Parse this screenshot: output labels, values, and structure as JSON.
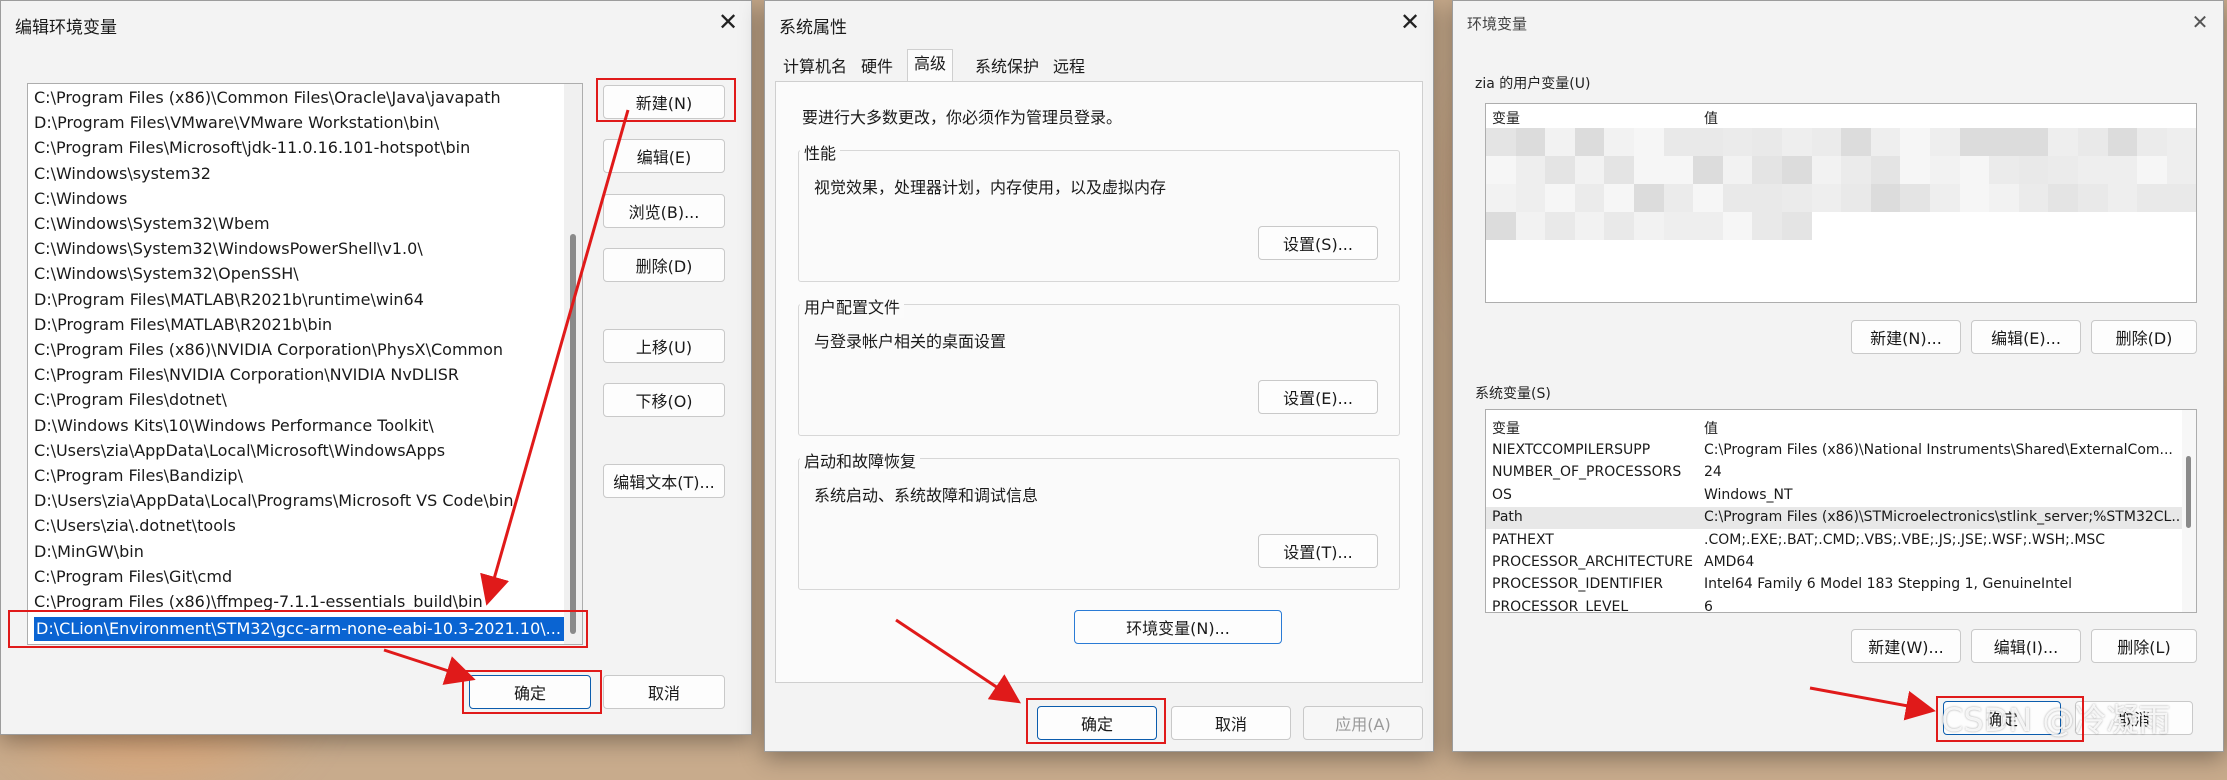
{
  "colors": {
    "highlight": "#e01a1a",
    "selection": "#0a64d2",
    "primary_border": "#0b5cad"
  },
  "edit_env_dialog": {
    "title": "编辑环境变量",
    "paths": [
      "C:\\Program Files (x86)\\Common Files\\Oracle\\Java\\javapath",
      "D:\\Program Files\\VMware\\VMware Workstation\\bin\\",
      "C:\\Program Files\\Microsoft\\jdk-11.0.16.101-hotspot\\bin",
      "C:\\Windows\\system32",
      "C:\\Windows",
      "C:\\Windows\\System32\\Wbem",
      "C:\\Windows\\System32\\WindowsPowerShell\\v1.0\\",
      "C:\\Windows\\System32\\OpenSSH\\",
      "D:\\Program Files\\MATLAB\\R2021b\\runtime\\win64",
      "D:\\Program Files\\MATLAB\\R2021b\\bin",
      "C:\\Program Files (x86)\\NVIDIA Corporation\\PhysX\\Common",
      "C:\\Program Files\\NVIDIA Corporation\\NVIDIA NvDLISR",
      "C:\\Program Files\\dotnet\\",
      "D:\\Windows Kits\\10\\Windows Performance Toolkit\\",
      "C:\\Users\\zia\\AppData\\Local\\Microsoft\\WindowsApps",
      "C:\\Program Files\\Bandizip\\",
      "D:\\Users\\zia\\AppData\\Local\\Programs\\Microsoft VS Code\\bin",
      "C:\\Users\\zia\\.dotnet\\tools",
      "D:\\MinGW\\bin",
      "C:\\Program Files\\Git\\cmd",
      "C:\\Program Files (x86)\\ffmpeg-7.1.1-essentials_build\\bin"
    ],
    "selected_path": "D:\\CLion\\Environment\\STM32\\gcc-arm-none-eabi-10.3-2021.10\\...",
    "buttons": {
      "new": "新建(N)",
      "edit": "编辑(E)",
      "browse": "浏览(B)...",
      "delete": "删除(D)",
      "move_up": "上移(U)",
      "move_down": "下移(O)",
      "edit_text": "编辑文本(T)...",
      "ok": "确定",
      "cancel": "取消"
    }
  },
  "system_properties": {
    "title": "系统属性",
    "tabs": [
      "计算机名",
      "硬件",
      "高级",
      "系统保护",
      "远程"
    ],
    "active_tab": "高级",
    "admin_hint": "要进行大多数更改，你必须作为管理员登录。",
    "performance": {
      "label": "性能",
      "desc": "视觉效果，处理器计划，内存使用，以及虚拟内存",
      "button": "设置(S)..."
    },
    "user_profile": {
      "label": "用户配置文件",
      "desc": "与登录帐户相关的桌面设置",
      "button": "设置(E)..."
    },
    "startup": {
      "label": "启动和故障恢复",
      "desc": "系统启动、系统故障和调试信息",
      "button": "设置(T)..."
    },
    "env_button": "环境变量(N)...",
    "ok": "确定",
    "cancel": "取消",
    "apply": "应用(A)"
  },
  "env_vars_window": {
    "title": "环境变量",
    "user_section_label": "zia 的用户变量(U)",
    "user_headers": {
      "var": "变量",
      "value": "值"
    },
    "user_buttons": {
      "new": "新建(N)...",
      "edit": "编辑(E)...",
      "delete": "删除(D)"
    },
    "system_section_label": "系统变量(S)",
    "system_headers": {
      "var": "变量",
      "value": "值"
    },
    "system_rows": [
      {
        "name": "NIEXTCCOMPILERSUPP",
        "value": "C:\\Program Files (x86)\\National Instruments\\Shared\\ExternalCom..."
      },
      {
        "name": "NUMBER_OF_PROCESSORS",
        "value": "24"
      },
      {
        "name": "OS",
        "value": "Windows_NT"
      },
      {
        "name": "Path",
        "value": "C:\\Program Files (x86)\\STMicroelectronics\\stlink_server;%STM32CL..."
      },
      {
        "name": "PATHEXT",
        "value": ".COM;.EXE;.BAT;.CMD;.VBS;.VBE;.JS;.JSE;.WSF;.WSH;.MSC"
      },
      {
        "name": "PROCESSOR_ARCHITECTURE",
        "value": "AMD64"
      },
      {
        "name": "PROCESSOR_IDENTIFIER",
        "value": "Intel64 Family 6 Model 183 Stepping 1, GenuineIntel"
      },
      {
        "name": "PROCESSOR_LEVEL",
        "value": "6"
      }
    ],
    "system_buttons": {
      "new": "新建(W)...",
      "edit": "编辑(I)...",
      "delete": "删除(L)"
    },
    "ok": "确定",
    "cancel": "取消",
    "watermark": "CSDN @冷凝雨"
  }
}
